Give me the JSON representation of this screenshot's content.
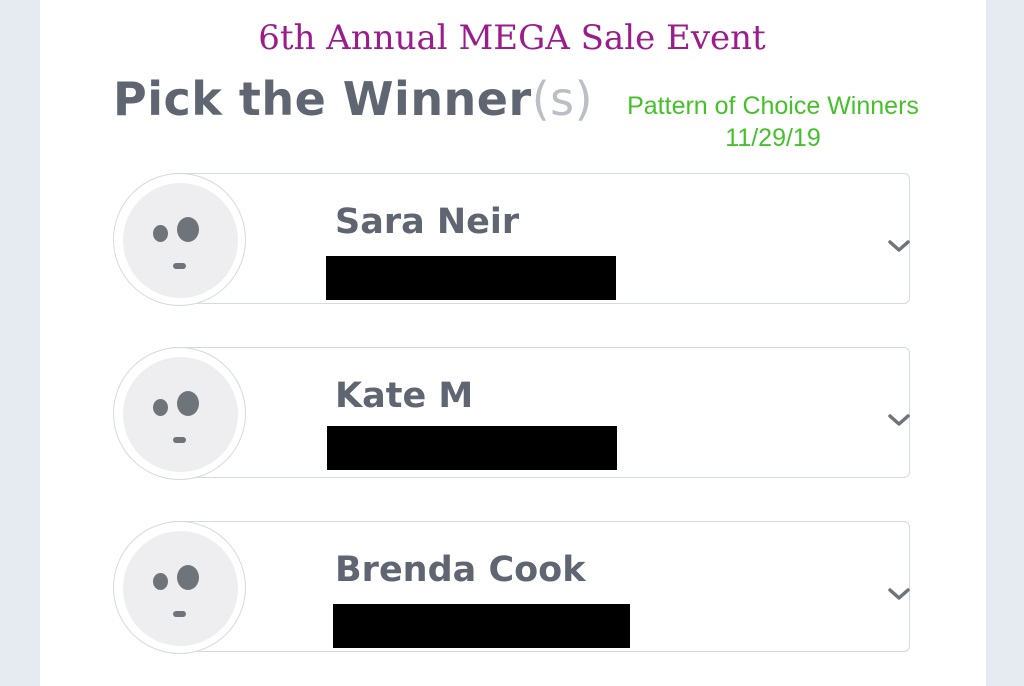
{
  "header": {
    "event_title": "6th Annual MEGA Sale Event",
    "pick_title_main": "Pick the Winner",
    "pick_title_suffix": "(s)",
    "note_line1": "Pattern of Choice Winners",
    "note_line2": "11/29/19"
  },
  "winners": [
    {
      "name": "Sara Neir",
      "detail_redacted": true,
      "expand_icon": "chevron-down-icon",
      "avatar_icon": "placeholder-face-icon"
    },
    {
      "name": "Kate M",
      "detail_redacted": true,
      "expand_icon": "chevron-down-icon",
      "avatar_icon": "placeholder-face-icon"
    },
    {
      "name": "Brenda Cook",
      "detail_redacted": true,
      "expand_icon": "chevron-down-icon",
      "avatar_icon": "placeholder-face-icon"
    }
  ],
  "colors": {
    "event_title": "#9b1d8c",
    "note_text": "#45c12a",
    "primary_text": "#5f6672",
    "muted_text": "#b9bec7",
    "border": "#d6d9de",
    "avatar_bg": "#eeeef0",
    "redaction": "#000000",
    "page_bg": "#e6ebf2"
  }
}
